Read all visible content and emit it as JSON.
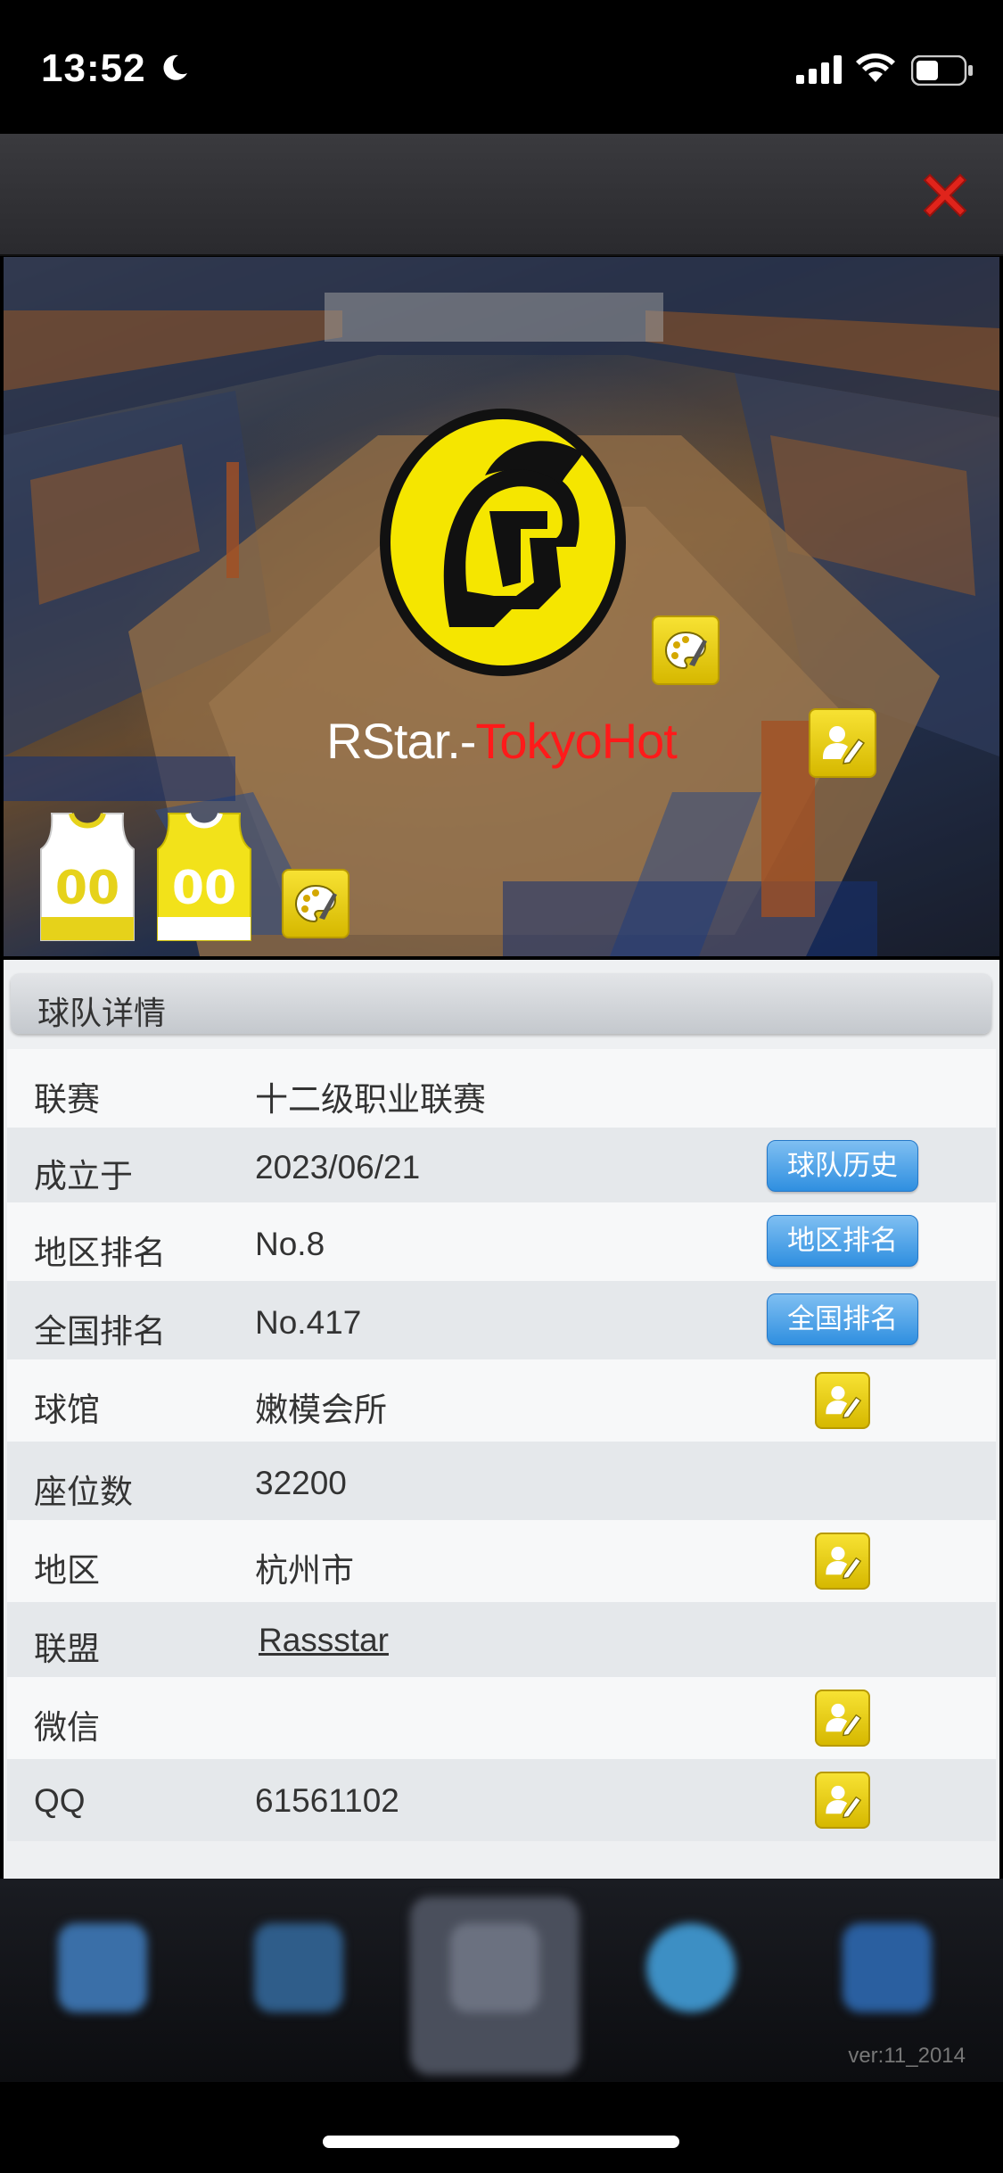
{
  "status_bar": {
    "time": "13:52"
  },
  "banner": {
    "team_name_part1": "RStar.-",
    "team_name_part2": "TokyoHot",
    "jersey_home_number": "00",
    "jersey_away_number": "00"
  },
  "details": {
    "title": "球队详情",
    "rows": [
      {
        "label": "联赛",
        "value": "十二级职业联赛"
      },
      {
        "label": "成立于",
        "value": "2023/06/21",
        "button": "球队历史"
      },
      {
        "label": "地区排名",
        "value": "No.8",
        "button": "地区排名"
      },
      {
        "label": "全国排名",
        "value": "No.417",
        "button": "全国排名"
      },
      {
        "label": "球馆",
        "value": "嫩模会所"
      },
      {
        "label": "座位数",
        "value": "32200"
      },
      {
        "label": "地区",
        "value": "杭州市"
      },
      {
        "label": "联盟",
        "value": "Rassstar"
      },
      {
        "label": "微信",
        "value": ""
      },
      {
        "label": "QQ",
        "value": "61561102"
      }
    ]
  },
  "bottom_nav": {
    "items": [
      "",
      "",
      "",
      "",
      ""
    ],
    "version": "ver:11_2014"
  },
  "colors": {
    "accent_yellow": "#f5e000",
    "button_blue": "#3f97e4",
    "name_red": "#ff1a1a"
  }
}
